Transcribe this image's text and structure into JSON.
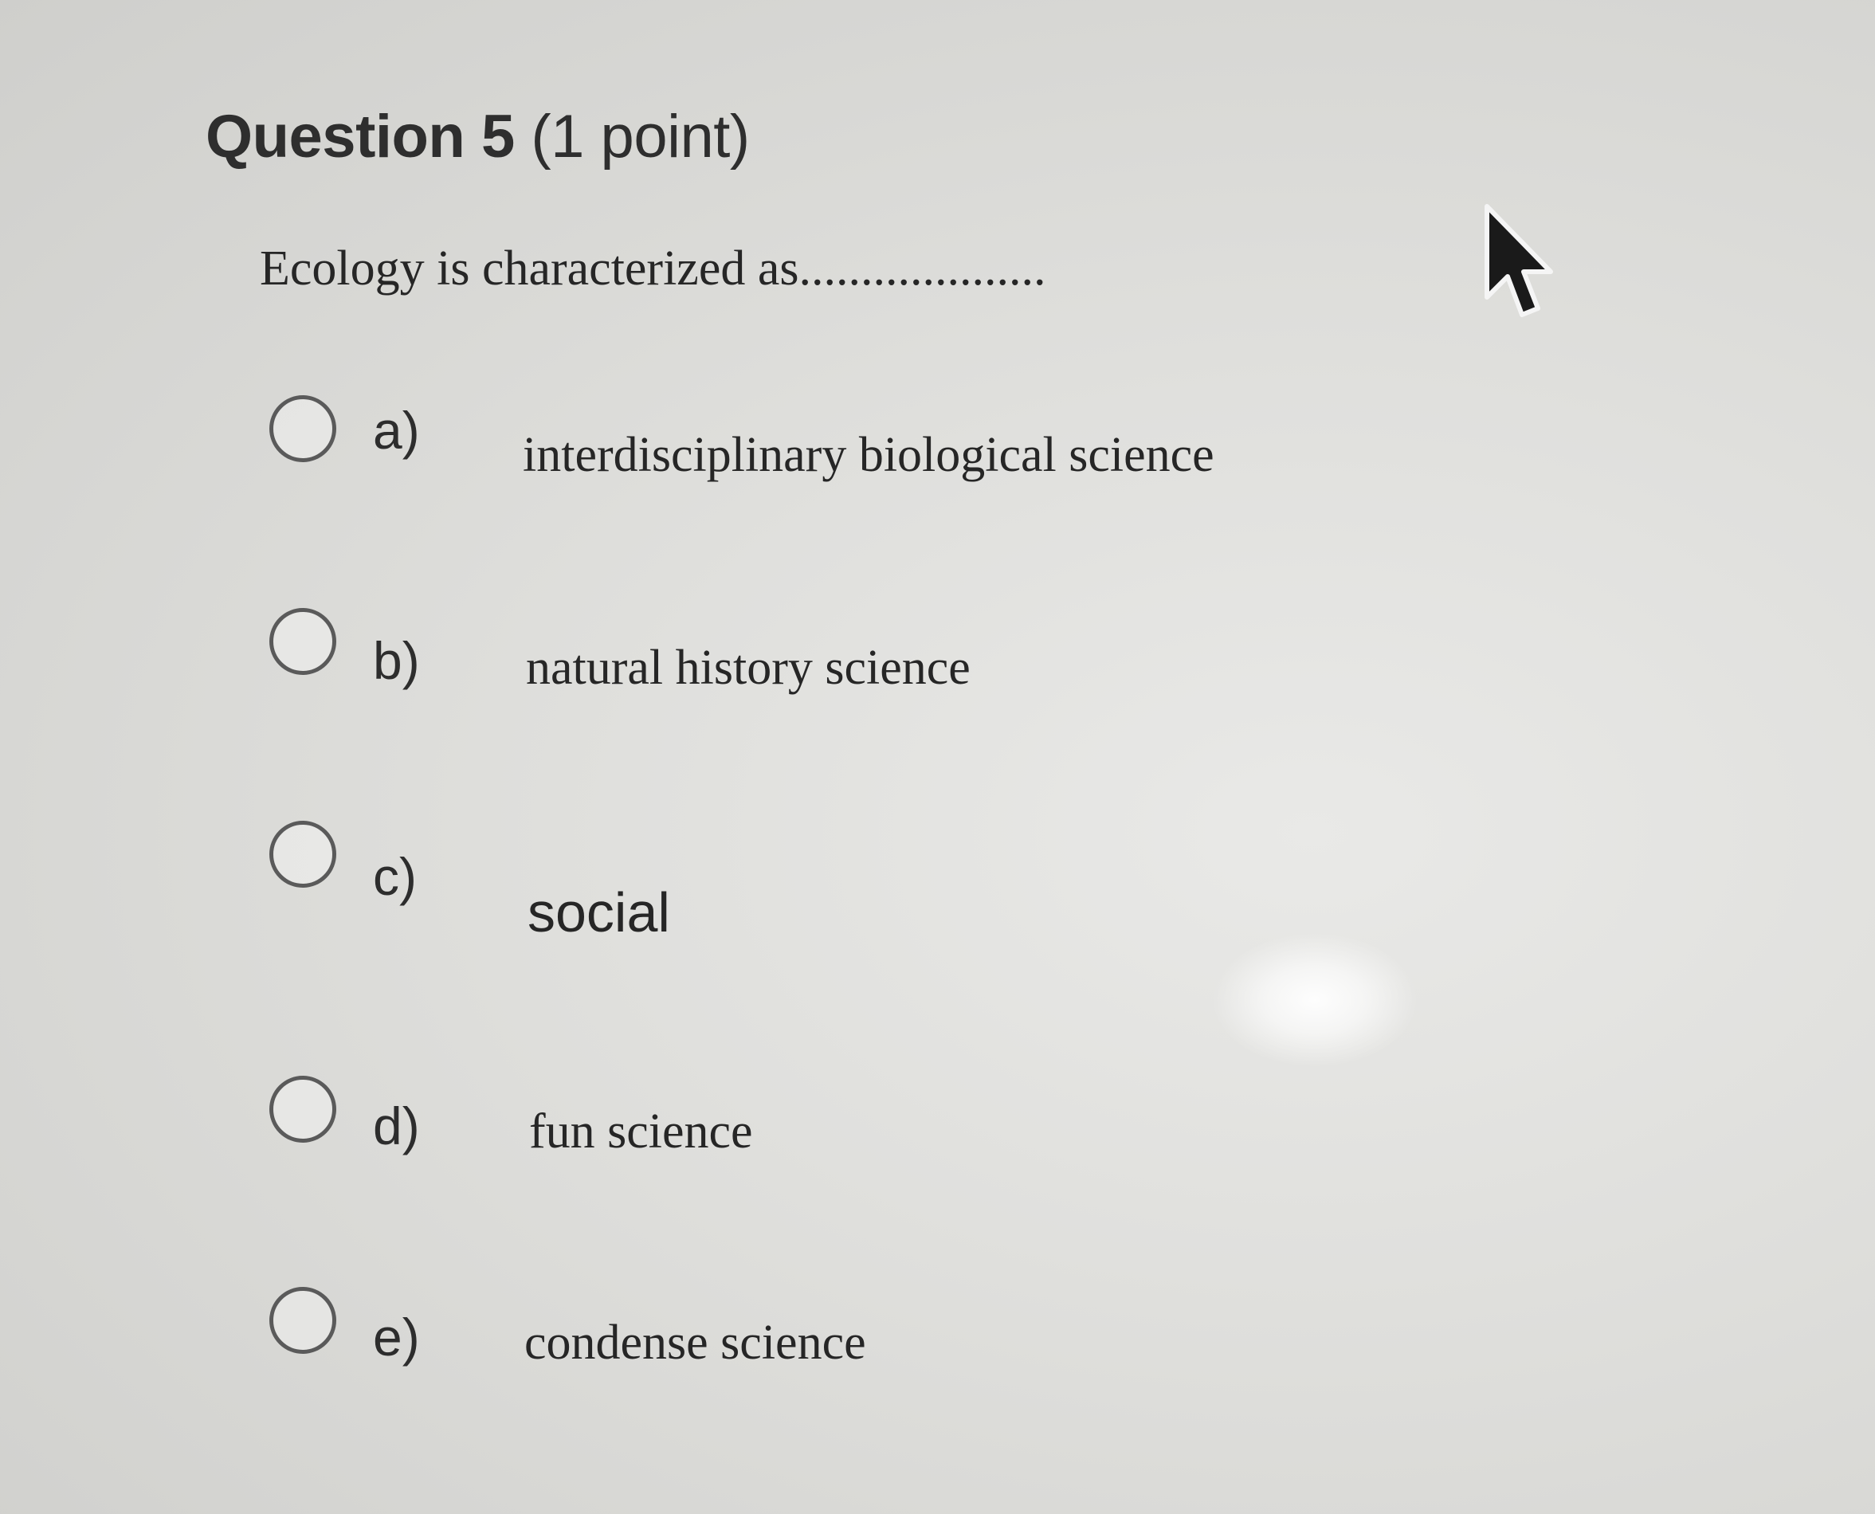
{
  "question": {
    "title_number": "Question 5",
    "title_points": "(1 point)",
    "prompt": "Ecology is characterized as...................."
  },
  "options": [
    {
      "letter": "a)",
      "text": "interdisciplinary biological science"
    },
    {
      "letter": "b)",
      "text": "natural history science"
    },
    {
      "letter": "c)",
      "text": "social"
    },
    {
      "letter": "d)",
      "text": "fun science"
    },
    {
      "letter": "e)",
      "text": "condense science"
    }
  ],
  "cursor_icon": "arrow-pointer-icon"
}
